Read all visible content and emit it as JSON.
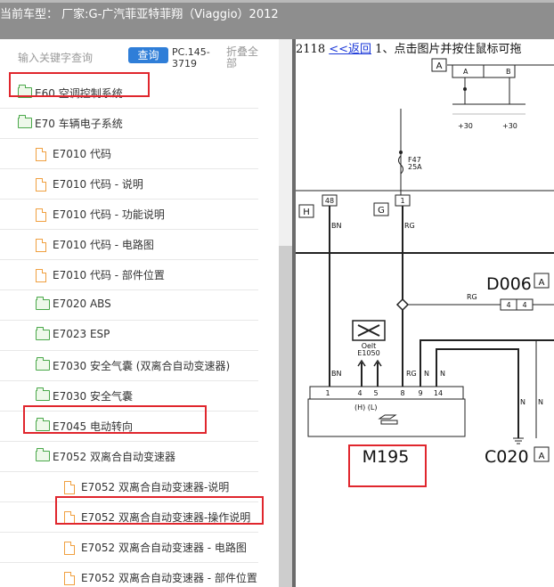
{
  "header": {
    "vehicle_label": "当前车型：",
    "vehicle_value": "厂家:G-广汽菲亚特菲翔（Viaggio）2012"
  },
  "search": {
    "placeholder": "输入关键字查询",
    "button_label": "查询",
    "code": "PC.145-3719",
    "collapse_label": "折叠全部"
  },
  "tree": [
    {
      "code": "E60",
      "label": "空调控制系统",
      "type": "folder"
    },
    {
      "code": "E70",
      "label": "车辆电子系统",
      "type": "folder",
      "open": true
    },
    {
      "code": "E7010",
      "label": "代码",
      "type": "doc"
    },
    {
      "code": "E7010",
      "label": "代码 - 说明",
      "type": "doc"
    },
    {
      "code": "E7010",
      "label": "代码 - 功能说明",
      "type": "doc"
    },
    {
      "code": "E7010",
      "label": "代码 - 电路图",
      "type": "doc"
    },
    {
      "code": "E7010",
      "label": "代码 - 部件位置",
      "type": "doc"
    },
    {
      "code": "E7020",
      "label": "ABS",
      "type": "folder"
    },
    {
      "code": "E7023",
      "label": "ESP",
      "type": "folder"
    },
    {
      "code": "E7030",
      "label": "安全气囊 (双离合自动变速器)",
      "type": "folder"
    },
    {
      "code": "E7030",
      "label": "安全气囊",
      "type": "folder"
    },
    {
      "code": "E7045",
      "label": "电动转向",
      "type": "folder"
    },
    {
      "code": "E7052",
      "label": "双离合自动变速器",
      "type": "folder",
      "open": true
    },
    {
      "code": "E7052",
      "label": "双离合自动变速器-说明",
      "type": "doc"
    },
    {
      "code": "E7052",
      "label": "双离合自动变速器-操作说明",
      "type": "doc"
    },
    {
      "code": "E7052",
      "label": "双离合自动变速器 - 电路图",
      "type": "doc",
      "selected": true
    },
    {
      "code": "E7052",
      "label": "双离合自动变速器 - 部件位置",
      "type": "doc"
    }
  ],
  "content": {
    "page_number": "2118",
    "back_link": "<<返回",
    "instruction": "1、点击图片并按住鼠标可拖"
  },
  "diagram": {
    "top_conn": "A",
    "pin_a": "A",
    "pin_b": "B",
    "plus30_a": "+30",
    "plus30_b": "+30",
    "fuse_name": "F47",
    "fuse_rating": "25A",
    "conn_h": "H",
    "conn_g": "G",
    "pin_48": "48",
    "pin_1": "1",
    "wire_bn": "BN",
    "wire_rg": "RG",
    "wire_n": "N",
    "d006": "D006",
    "d006_conn": "A",
    "d006_pin": "4",
    "e1050": "E1050",
    "e1050_tag": "Oelt",
    "m195": "M195",
    "m195_pins": [
      "1",
      "4",
      "5",
      "8",
      "9",
      "14"
    ],
    "m195_hl": "(H)  (L)",
    "c020": "C020",
    "c020_conn": "A"
  },
  "colors": {
    "highlight": "#e0262d",
    "button": "#2f7ed8",
    "link": "#1a37d8",
    "folder": "#4aa84a",
    "doc": "#f0a040"
  }
}
